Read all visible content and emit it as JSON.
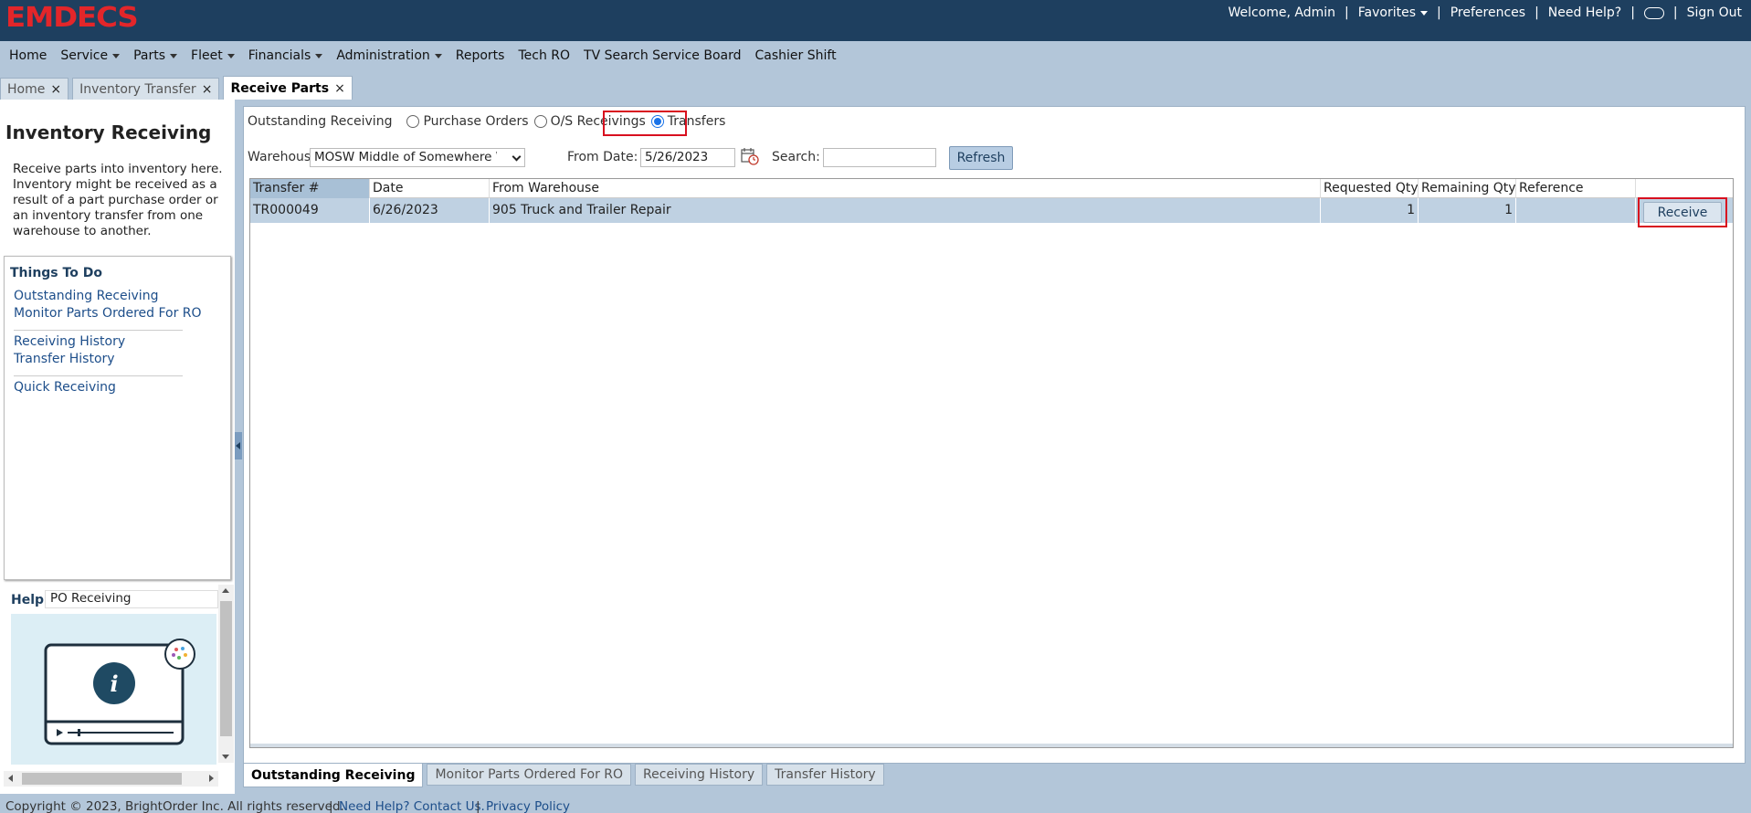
{
  "header": {
    "logo": "EMDECS",
    "welcome": "Welcome, Admin",
    "favorites": "Favorites",
    "preferences": "Preferences",
    "need_help": "Need Help?",
    "sign_out": "Sign Out",
    "separator": "|"
  },
  "menu": {
    "items": [
      {
        "label": "Home",
        "has_dropdown": false
      },
      {
        "label": "Service",
        "has_dropdown": true
      },
      {
        "label": "Parts",
        "has_dropdown": true
      },
      {
        "label": "Fleet",
        "has_dropdown": true
      },
      {
        "label": "Financials",
        "has_dropdown": true
      },
      {
        "label": "Administration",
        "has_dropdown": true
      },
      {
        "label": "Reports",
        "has_dropdown": false
      },
      {
        "label": "Tech RO",
        "has_dropdown": false
      },
      {
        "label": "TV Search Service Board",
        "has_dropdown": false
      },
      {
        "label": "Cashier Shift",
        "has_dropdown": false
      }
    ]
  },
  "tabs": [
    {
      "label": "Home",
      "close": "×",
      "active": false
    },
    {
      "label": "Inventory Transfer",
      "close": "×",
      "active": false
    },
    {
      "label": "Receive Parts",
      "close": "×",
      "active": true
    }
  ],
  "left_panel": {
    "title": "Inventory Receiving",
    "description": "Receive parts into inventory here. Inventory might be received as a result of a part purchase order or an inventory transfer from one warehouse to another.",
    "things_to_do": {
      "title": "Things To Do",
      "links": [
        "Outstanding Receiving",
        "Monitor Parts Ordered For RO",
        "Receiving History",
        "Transfer History",
        "Quick Receiving"
      ]
    },
    "help": {
      "label": "Help",
      "topic": "PO Receiving"
    }
  },
  "filters": {
    "outstanding_label": "Outstanding Receiving",
    "radios": [
      {
        "label": "Purchase Orders",
        "checked": false
      },
      {
        "label": "O/S Receivings",
        "checked": false
      },
      {
        "label": "Transfers",
        "checked": true
      }
    ],
    "warehouse_label": "Warehouse:",
    "warehouse_value": "MOSW Middle of Somewhere Warehouse",
    "from_date_label": "From Date:",
    "from_date_value": "5/26/2023",
    "search_label": "Search:",
    "search_value": "",
    "refresh_label": "Refresh"
  },
  "grid": {
    "columns": [
      "Transfer #",
      "Date",
      "From Warehouse",
      "Requested Qty",
      "Remaining Qty",
      "Reference",
      ""
    ],
    "rows": [
      {
        "transfer_no": "TR000049",
        "date": "6/26/2023",
        "from_warehouse": "905 Truck and Trailer Repair",
        "requested_qty": "1",
        "remaining_qty": "1",
        "reference": "",
        "action": "Receive"
      }
    ]
  },
  "bottom_tabs": [
    {
      "label": "Outstanding Receiving",
      "active": true
    },
    {
      "label": "Monitor Parts Ordered For RO",
      "active": false
    },
    {
      "label": "Receiving History",
      "active": false
    },
    {
      "label": "Transfer History",
      "active": false
    }
  ],
  "footer": {
    "copyright": "Copyright © 2023, BrightOrder Inc. All rights reserved.",
    "sep": "|",
    "contact": "Need Help? Contact Us.",
    "privacy": "Privacy Policy"
  },
  "colors": {
    "header_bg": "#1e3f5f",
    "logo_red": "#e3262a",
    "menu_bg": "#b3c6d9",
    "highlight_red": "#d8101f",
    "selected_row": "#bfd1e2"
  }
}
